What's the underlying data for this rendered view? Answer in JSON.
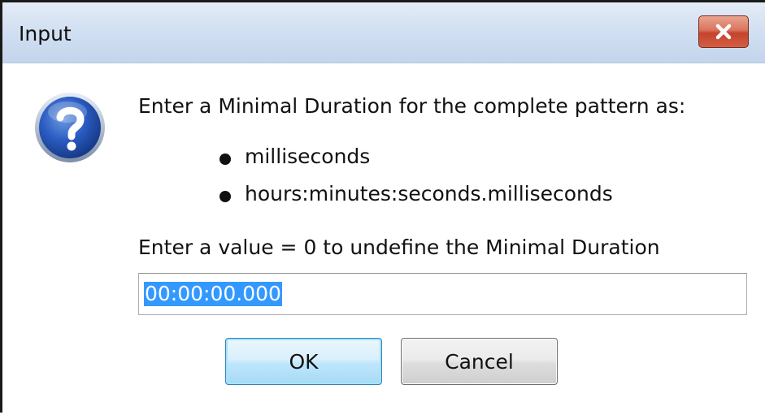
{
  "window": {
    "title": "Input",
    "close_icon": "close-icon"
  },
  "dialog": {
    "icon": "question-icon",
    "prompt": "Enter a Minimal Duration for the complete pattern as:",
    "formats": [
      "milliseconds",
      "hours:minutes:seconds.milliseconds"
    ],
    "hint": "Enter a value = 0 to undefine the Minimal Duration",
    "input": {
      "value": "00:00:00.000",
      "selected": true
    }
  },
  "buttons": {
    "ok_label": "OK",
    "cancel_label": "Cancel"
  },
  "colors": {
    "selection": "#3399ff",
    "title_bar": "#d2e0f2",
    "close_button": "#c4432d"
  }
}
